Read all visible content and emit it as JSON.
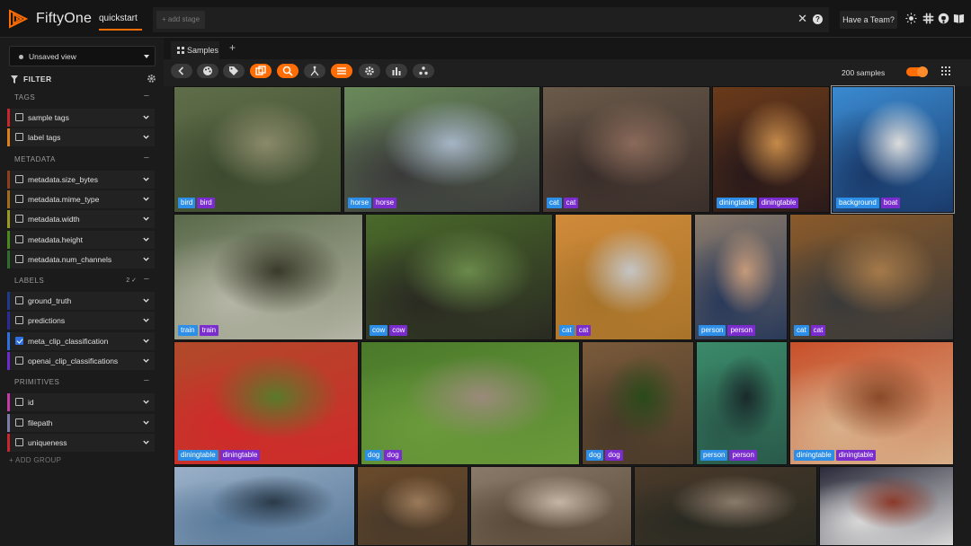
{
  "app": {
    "brand": "FiftyOne",
    "dataset": "quickstart",
    "add_stage_placeholder": "+ add stage",
    "team_button": "Have a Team?",
    "icons": [
      "sun-icon",
      "slack-icon",
      "github-icon",
      "docs-icon"
    ]
  },
  "sidebar": {
    "view": "Unsaved view",
    "filter_title": "FILTER",
    "groups": [
      {
        "title": "TAGS",
        "count": "",
        "fields": [
          {
            "label": "sample tags",
            "color": "#c8262b",
            "checked": false
          },
          {
            "label": "label tags",
            "color": "#e07e1c",
            "checked": false
          }
        ]
      },
      {
        "title": "METADATA",
        "count": "",
        "fields": [
          {
            "label": "metadata.size_bytes",
            "color": "#8c3f1a",
            "checked": false
          },
          {
            "label": "metadata.mime_type",
            "color": "#a66a1a",
            "checked": false
          },
          {
            "label": "metadata.width",
            "color": "#9a9a1e",
            "checked": false
          },
          {
            "label": "metadata.height",
            "color": "#4a8a1a",
            "checked": false
          },
          {
            "label": "metadata.num_channels",
            "color": "#2d6e2d",
            "checked": false
          }
        ]
      },
      {
        "title": "LABELS",
        "count": "2",
        "fields": [
          {
            "label": "ground_truth",
            "color": "#1d3a8c",
            "checked": false
          },
          {
            "label": "predictions",
            "color": "#2a2a9a",
            "checked": false
          },
          {
            "label": "meta_clip_classification",
            "color": "#2d6ee0",
            "checked": true
          },
          {
            "label": "openai_clip_classifications",
            "color": "#6a2ccf",
            "checked": false
          }
        ]
      },
      {
        "title": "PRIMITIVES",
        "count": "",
        "fields": [
          {
            "label": "id",
            "color": "#c23ba8",
            "checked": false
          },
          {
            "label": "filepath",
            "color": "#7c7ca8",
            "checked": false
          },
          {
            "label": "uniqueness",
            "color": "#c8262b",
            "checked": false
          }
        ]
      }
    ],
    "add_group": "+ ADD GROUP"
  },
  "main": {
    "tab": "Samples",
    "sample_count": "200 samples",
    "tiles": [
      {
        "gt": "bird",
        "pred": "bird",
        "colors": [
          "#5f6e49",
          "#3d4a2f",
          "#8a8a6a"
        ]
      },
      {
        "gt": "horse",
        "pred": "horse",
        "colors": [
          "#6a8a5a",
          "#3a3a3a",
          "#a5b5c5"
        ]
      },
      {
        "gt": "cat",
        "pred": "cat",
        "colors": [
          "#6a5a4a",
          "#3a2e2a",
          "#8a6a5a"
        ]
      },
      {
        "gt": "diningtable",
        "pred": "diningtable",
        "colors": [
          "#6a3a1a",
          "#2a1a1a",
          "#c58a4a"
        ]
      },
      {
        "gt": "background",
        "pred": "boat",
        "colors": [
          "#3a8ad0",
          "#1a3a6a",
          "#dcdcdc"
        ]
      },
      {
        "gt": "train",
        "pred": "train",
        "colors": [
          "#5a6a4a",
          "#b5b5a5",
          "#3a3a2a"
        ]
      },
      {
        "gt": "cow",
        "pred": "cow",
        "colors": [
          "#4a6a2a",
          "#2a2a22",
          "#6a8a4a"
        ]
      },
      {
        "gt": "cat",
        "pred": "cat",
        "colors": [
          "#d08a3a",
          "#a8742a",
          "#c5c5c5"
        ]
      },
      {
        "gt": "person",
        "pred": "person",
        "colors": [
          "#8a7a6a",
          "#2a3a5a",
          "#c59a7a"
        ]
      },
      {
        "gt": "cat",
        "pred": "cat",
        "colors": [
          "#8a5a2a",
          "#3a3a3a",
          "#a57a4a"
        ]
      },
      {
        "gt": "diningtable",
        "pred": "diningtable",
        "colors": [
          "#b04a2a",
          "#d02a2a",
          "#5a7a2a"
        ]
      },
      {
        "gt": "dog",
        "pred": "dog",
        "colors": [
          "#4a7a2a",
          "#6a9a3a",
          "#9a8a7a"
        ]
      },
      {
        "gt": "dog",
        "pred": "dog",
        "colors": [
          "#7a5a3a",
          "#4a3a2a",
          "#2a4a1a"
        ]
      },
      {
        "gt": "person",
        "pred": "person",
        "colors": [
          "#3a8a6a",
          "#2a5a4a",
          "#1a2a2a"
        ]
      },
      {
        "gt": "diningtable",
        "pred": "diningtable",
        "colors": [
          "#c8502a",
          "#d8b08a",
          "#8a4a2a"
        ]
      },
      {
        "gt": "",
        "pred": "",
        "colors": [
          "#9ab0c8",
          "#5a7a9a",
          "#2a3a4a"
        ]
      },
      {
        "gt": "",
        "pred": "",
        "colors": [
          "#6a4a2a",
          "#4a3a2a",
          "#9a7a5a"
        ]
      },
      {
        "gt": "",
        "pred": "",
        "colors": [
          "#8a7a6a",
          "#5a4a3a",
          "#c5b5a5"
        ]
      },
      {
        "gt": "",
        "pred": "",
        "colors": [
          "#4a3a2a",
          "#2a2a22",
          "#8a7a6a"
        ]
      },
      {
        "gt": "",
        "pred": "",
        "colors": [
          "#2a2a3a",
          "#d8d8d8",
          "#8a3a2a"
        ]
      }
    ]
  }
}
